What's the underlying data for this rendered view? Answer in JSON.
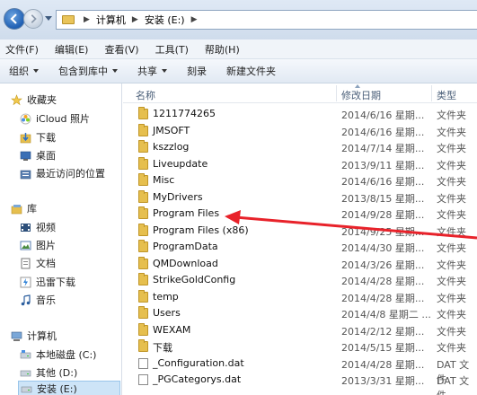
{
  "address": {
    "crumbs": [
      "计算机",
      "安装 (E:)"
    ]
  },
  "menu": [
    "文件(F)",
    "编辑(E)",
    "查看(V)",
    "工具(T)",
    "帮助(H)"
  ],
  "toolbar": {
    "organize": "组织",
    "include_library": "包含到库中",
    "share": "共享",
    "burn": "刻录",
    "new_folder": "新建文件夹"
  },
  "sidebar": {
    "favorites": "收藏夹",
    "icloud": "iCloud 照片",
    "downloads": "下载",
    "desktop": "桌面",
    "recent": "最近访问的位置",
    "libraries": "库",
    "videos": "视频",
    "pictures": "图片",
    "documents": "文档",
    "thunder": "迅雷下载",
    "music": "音乐",
    "computer": "计算机",
    "drive_c": "本地磁盘 (C:)",
    "drive_d": "其他 (D:)",
    "drive_e": "安装 (E:)"
  },
  "columns": {
    "name": "名称",
    "date": "修改日期",
    "type": "类型"
  },
  "files": [
    {
      "name": "1211774265",
      "date": "2014/6/16 星期...",
      "type": "文件夹",
      "kind": "folder"
    },
    {
      "name": "JMSOFT",
      "date": "2014/6/16 星期...",
      "type": "文件夹",
      "kind": "folder"
    },
    {
      "name": "kszzlog",
      "date": "2014/7/14 星期...",
      "type": "文件夹",
      "kind": "folder"
    },
    {
      "name": "Liveupdate",
      "date": "2013/9/11 星期...",
      "type": "文件夹",
      "kind": "folder"
    },
    {
      "name": "Misc",
      "date": "2014/6/16 星期...",
      "type": "文件夹",
      "kind": "folder"
    },
    {
      "name": "MyDrivers",
      "date": "2013/8/15 星期...",
      "type": "文件夹",
      "kind": "folder"
    },
    {
      "name": "Program Files",
      "date": "2014/9/28 星期...",
      "type": "文件夹",
      "kind": "folder"
    },
    {
      "name": "Program Files (x86)",
      "date": "2014/9/25 星期...",
      "type": "文件夹",
      "kind": "folder"
    },
    {
      "name": "ProgramData",
      "date": "2014/4/30 星期...",
      "type": "文件夹",
      "kind": "folder"
    },
    {
      "name": "QMDownload",
      "date": "2014/3/26 星期...",
      "type": "文件夹",
      "kind": "folder"
    },
    {
      "name": "StrikeGoldConfig",
      "date": "2014/4/28 星期...",
      "type": "文件夹",
      "kind": "folder"
    },
    {
      "name": "temp",
      "date": "2014/4/28 星期...",
      "type": "文件夹",
      "kind": "folder"
    },
    {
      "name": "Users",
      "date": "2014/4/8 星期二 ...",
      "type": "文件夹",
      "kind": "folder"
    },
    {
      "name": "WEXAM",
      "date": "2014/2/12 星期...",
      "type": "文件夹",
      "kind": "folder"
    },
    {
      "name": "下载",
      "date": "2014/5/15 星期...",
      "type": "文件夹",
      "kind": "folder"
    },
    {
      "name": "_Configuration.dat",
      "date": "2014/4/28 星期...",
      "type": "DAT 文件",
      "kind": "file"
    },
    {
      "name": "_PGCategorys.dat",
      "date": "2013/3/31 星期...",
      "type": "DAT 文件",
      "kind": "file"
    }
  ],
  "colors": {
    "arrow": "#e8222a",
    "selection": "#cde4f7"
  }
}
